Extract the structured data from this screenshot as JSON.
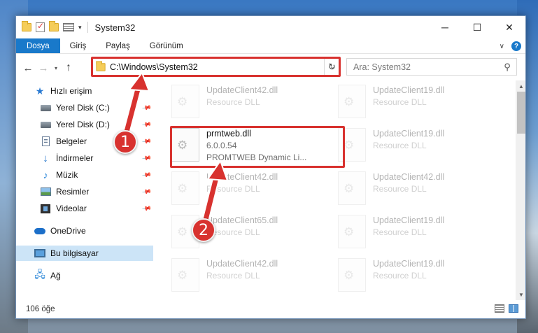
{
  "window": {
    "title": "System32",
    "controls": {
      "minimize": "─",
      "maximize": "☐",
      "close": "✕"
    }
  },
  "ribbon": {
    "tabs": [
      "Dosya",
      "Giriş",
      "Paylaş",
      "Görünüm"
    ]
  },
  "address": {
    "path": "C:\\Windows\\System32",
    "search_placeholder": "Ara: System32"
  },
  "sidebar": {
    "quick_access": "Hızlı erişim",
    "items": [
      {
        "label": "Yerel Disk (C:)",
        "icon": "drive-icon",
        "pinned": true
      },
      {
        "label": "Yerel Disk (D:)",
        "icon": "drive-icon",
        "pinned": true
      },
      {
        "label": "Belgeler",
        "icon": "documents-icon",
        "pinned": true
      },
      {
        "label": "İndirmeler",
        "icon": "downloads-icon",
        "pinned": true
      },
      {
        "label": "Müzik",
        "icon": "music-icon",
        "pinned": true
      },
      {
        "label": "Resimler",
        "icon": "pictures-icon",
        "pinned": true
      },
      {
        "label": "Videolar",
        "icon": "videos-icon",
        "pinned": true
      }
    ],
    "onedrive": "OneDrive",
    "this_pc": "Bu bilgisayar",
    "network": "Ağ"
  },
  "files": {
    "left_column": [
      {
        "name": "UpdateClient42.dll",
        "meta": "Resource DLL",
        "faded": true
      },
      {
        "name": "prmtweb.dll",
        "version": "6.0.0.54",
        "description": "PROMTWEB Dynamic Li...",
        "faded": false
      },
      {
        "name": "UpdateClient42.dll",
        "meta": "Resource DLL",
        "faded": true
      },
      {
        "name": "UpdateClient65.dll",
        "meta": "Resource DLL",
        "faded": true
      },
      {
        "name": "UpdateClient42.dll",
        "meta": "Resource DLL",
        "faded": true
      }
    ],
    "right_column": [
      {
        "name": "UpdateClient19.dll",
        "meta": "Resource DLL",
        "faded": true
      },
      {
        "name": "UpdateClient19.dll",
        "meta": "Resource DLL",
        "faded": true
      },
      {
        "name": "UpdateClient42.dll",
        "meta": "Resource DLL",
        "faded": true
      },
      {
        "name": "UpdateClient19.dll",
        "meta": "Resource DLL",
        "faded": true
      },
      {
        "name": "UpdateClient19.dll",
        "meta": "Resource DLL",
        "faded": true
      }
    ]
  },
  "status": {
    "item_count": "106 öğe"
  },
  "callouts": {
    "first": "1",
    "second": "2"
  },
  "colors": {
    "accent": "#1979ca",
    "highlight": "#d8322f",
    "selection": "#cce4f7"
  }
}
